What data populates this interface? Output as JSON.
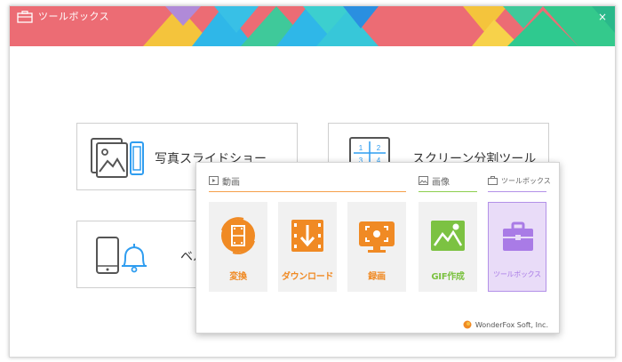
{
  "window": {
    "title": "ツールボックス",
    "close_glyph": "×"
  },
  "cards": [
    {
      "label": "写真スライドショー",
      "icon": "photo-slideshow-icon"
    },
    {
      "label": "スクリーン分割ツール",
      "icon": "split-screen-icon"
    },
    {
      "label": "ベル",
      "icon": "phone-bell-icon"
    }
  ],
  "split_icon_numbers": [
    "1",
    "2",
    "3",
    "4"
  ],
  "popup": {
    "sections": [
      {
        "title": "動画",
        "icon": "video-icon",
        "line_color": "#f5a04a"
      },
      {
        "title": "画像",
        "icon": "image-icon",
        "line_color": "#8ccf4e"
      },
      {
        "title": "ツールボックス",
        "icon": "toolbox-icon",
        "line_color": "#b391e8"
      }
    ],
    "tools": [
      {
        "label": "変換",
        "icon": "film-convert-icon",
        "color": "#f08a24"
      },
      {
        "label": "ダウンロード",
        "icon": "download-icon",
        "color": "#f08a24"
      },
      {
        "label": "録画",
        "icon": "screen-record-icon",
        "color": "#f08a24"
      },
      {
        "label": "GIF作成",
        "icon": "gif-image-icon",
        "color": "#7cc242"
      },
      {
        "label": "ツールボックス",
        "icon": "toolbox-icon",
        "color": "#a97be6"
      }
    ],
    "brand": "WonderFox Soft, Inc."
  },
  "colors": {
    "title_red": "#ec6c74",
    "orange": "#f08a24",
    "green": "#7cc242",
    "purple": "#a97be6"
  }
}
